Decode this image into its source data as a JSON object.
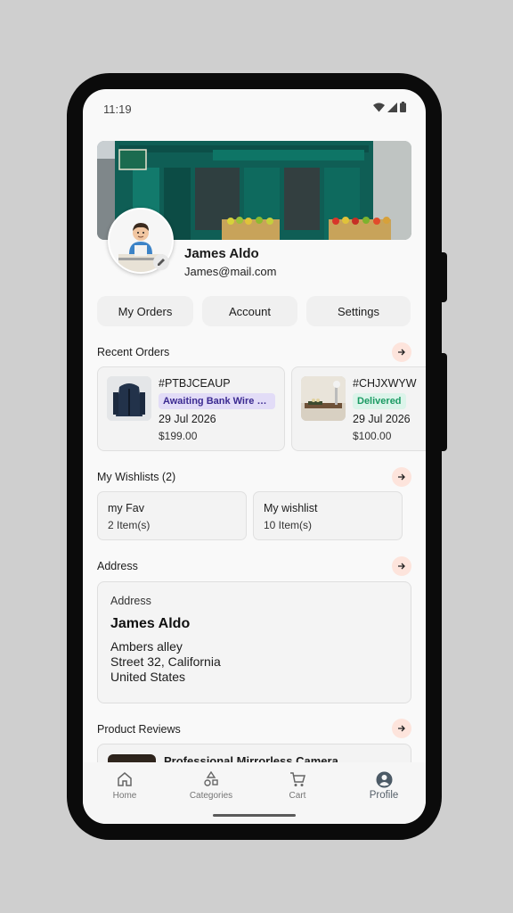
{
  "status_bar": {
    "time": "11:19"
  },
  "profile": {
    "name": "James Aldo",
    "email": "James@mail.com"
  },
  "tabs": [
    "My Orders",
    "Account",
    "Settings"
  ],
  "recent_orders": {
    "title": "Recent Orders",
    "items": [
      {
        "id": "#PTBJCEAUP",
        "status": "Awaiting Bank Wire Pay...",
        "date": "29 Jul 2026",
        "price": "$199.00",
        "status_color": "#e2dcf7"
      },
      {
        "id": "#CHJXWYW",
        "status": "Delivered",
        "date": "29 Jul 2026",
        "price": "$100.00",
        "status_color": "#dcf4ea"
      }
    ]
  },
  "wishlists": {
    "title": "My Wishlists (2)",
    "items": [
      {
        "name": "my Fav",
        "count": "2 Item(s)"
      },
      {
        "name": "My wishlist",
        "count": "10 Item(s)"
      }
    ]
  },
  "address": {
    "title": "Address",
    "card_label": "Address",
    "name": "James Aldo",
    "lines": [
      "Ambers alley",
      "Street 32, California",
      "United States"
    ]
  },
  "product_reviews": {
    "title": "Product Reviews",
    "first_item": "Professional Mirrorless Camera"
  },
  "bottom_nav": {
    "items": [
      {
        "label": "Home",
        "icon": "home-icon"
      },
      {
        "label": "Categories",
        "icon": "categories-icon"
      },
      {
        "label": "Cart",
        "icon": "cart-icon"
      },
      {
        "label": "Profile",
        "icon": "profile-icon"
      }
    ],
    "active": "Profile"
  },
  "colors": {
    "accent_soft": "#fde4dc",
    "badge_purple_text": "#3b2a91",
    "badge_green_text": "#1b9a63"
  }
}
